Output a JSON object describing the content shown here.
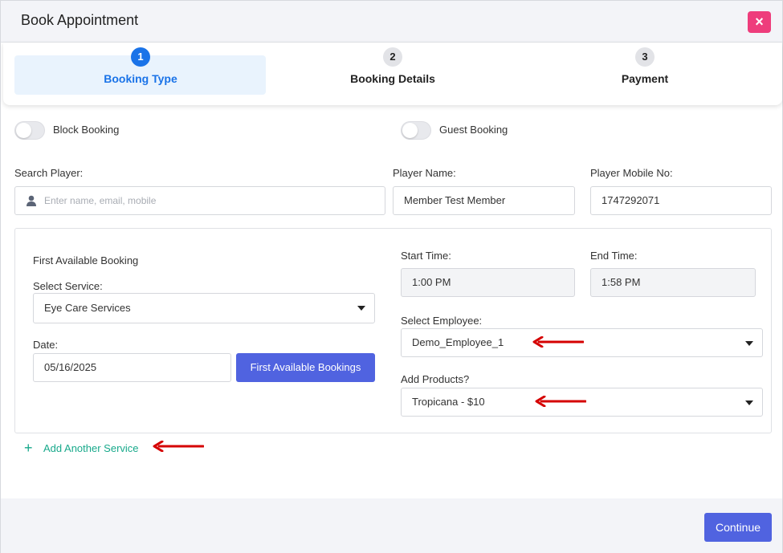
{
  "modal": {
    "title": "Book Appointment",
    "close_label": "×"
  },
  "stepper": {
    "steps": [
      {
        "number": "1",
        "label": "Booking Type",
        "active": true
      },
      {
        "number": "2",
        "label": "Booking Details",
        "active": false
      },
      {
        "number": "3",
        "label": "Payment",
        "active": false
      }
    ]
  },
  "toggles": {
    "block_booking": {
      "label": "Block Booking",
      "checked": false
    },
    "guest_booking": {
      "label": "Guest Booking",
      "checked": false
    }
  },
  "player": {
    "search_label": "Search Player:",
    "search_placeholder": "Enter name, email, mobile",
    "name_label": "Player Name:",
    "name_value": "Member Test Member",
    "mobile_label": "Player Mobile No:",
    "mobile_value": "1747292071"
  },
  "service_panel": {
    "heading": "First Available Booking",
    "service_label": "Select Service:",
    "service_value": "Eye Care Services",
    "date_label": "Date:",
    "date_value": "05/16/2025",
    "first_available_button": "First Available Bookings",
    "start_label": "Start Time:",
    "start_value": "1:00 PM",
    "end_label": "End Time:",
    "end_value": "1:58 PM",
    "employee_label": "Select Employee:",
    "employee_value": "Demo_Employee_1",
    "products_label": "Add Products?",
    "products_value": "Tropicana - $10"
  },
  "add_service": {
    "icon": "plus-icon",
    "label": "Add Another Service"
  },
  "footer": {
    "continue_label": "Continue"
  },
  "colors": {
    "primary": "#5063e0",
    "step_active": "#1a73e8",
    "close": "#ee3d7c",
    "link": "#18a98b",
    "annotation_arrow": "#d50000"
  }
}
